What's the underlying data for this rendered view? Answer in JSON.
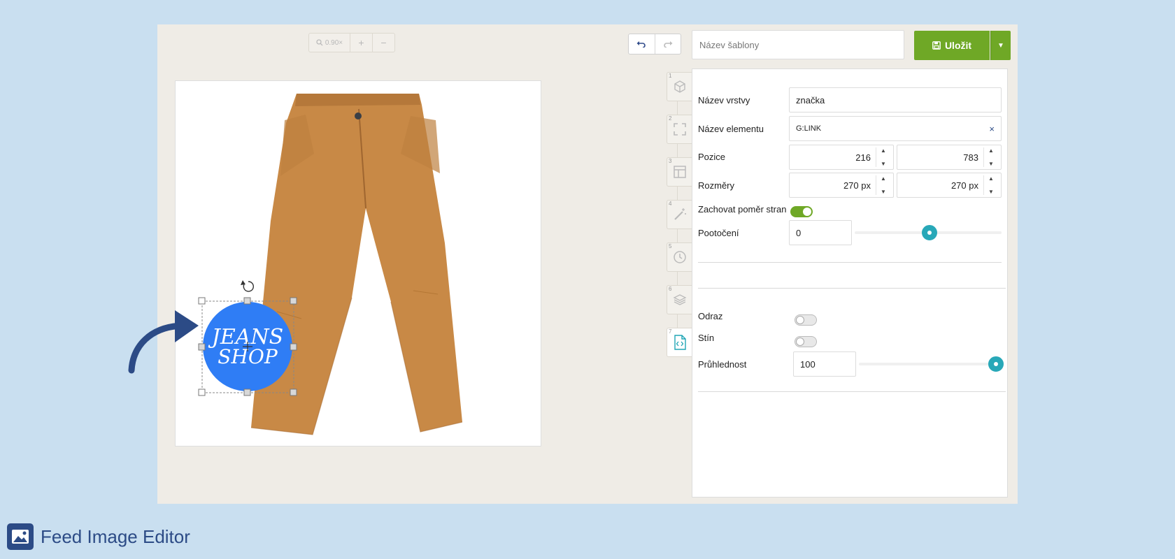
{
  "toolbar": {
    "zoom_label": "0.90×",
    "zoom_in": "+",
    "zoom_out": "−",
    "undo_icon": "undo-icon",
    "redo_icon": "redo-icon"
  },
  "header": {
    "template_name_placeholder": "Název šablony",
    "save_label": "Uložit"
  },
  "canvas": {
    "logo_line1": "JEANS",
    "logo_line2": "SHOP"
  },
  "tabs": [
    {
      "num": "1",
      "icon": "cube-icon"
    },
    {
      "num": "2",
      "icon": "fullscreen-icon"
    },
    {
      "num": "3",
      "icon": "layout-icon"
    },
    {
      "num": "4",
      "icon": "magic-wand-icon"
    },
    {
      "num": "5",
      "icon": "clock-icon"
    },
    {
      "num": "6",
      "icon": "layers-icon"
    },
    {
      "num": "7",
      "icon": "code-file-icon"
    }
  ],
  "panel": {
    "layer_name_label": "Název vrstvy",
    "layer_name_value": "značka",
    "element_name_label": "Název elementu",
    "element_name_value": "G:LINK",
    "element_clear": "×",
    "position_label": "Pozice",
    "position_x": "216",
    "position_y": "783",
    "size_label": "Rozměry",
    "size_w": "270 px",
    "size_h": "270 px",
    "keep_ratio_label": "Zachovat poměr stran",
    "keep_ratio_on": true,
    "rotation_label": "Pootočení",
    "rotation_value": "0",
    "reflection_label": "Odraz",
    "reflection_on": false,
    "shadow_label": "Stín",
    "shadow_on": false,
    "opacity_label": "Průhlednost",
    "opacity_value": "100"
  },
  "footer": {
    "brand_name": "Feed Image Editor"
  },
  "colors": {
    "accent_green": "#6fa826",
    "accent_teal": "#28a8b8",
    "brand_blue": "#2c4b86",
    "logo_blue": "#2f7df5"
  }
}
